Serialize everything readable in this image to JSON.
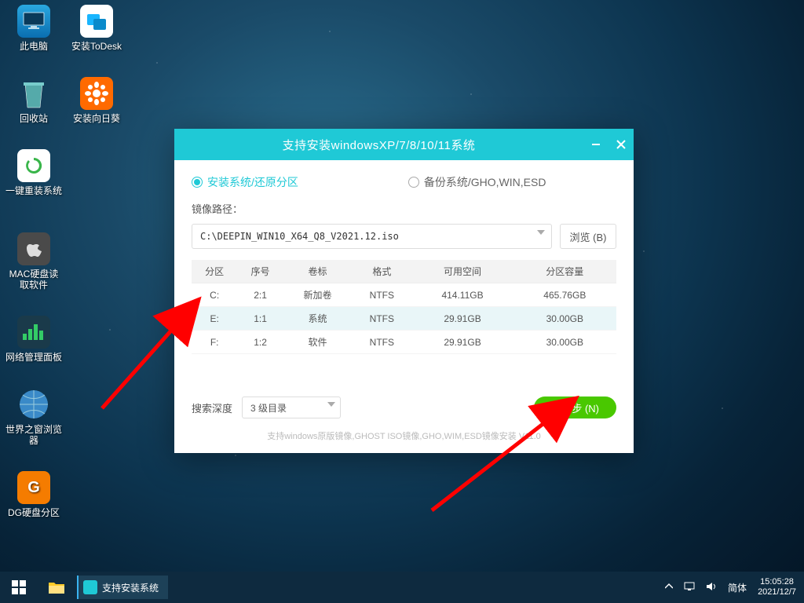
{
  "desktop": {
    "icons": [
      {
        "label": "此电脑"
      },
      {
        "label": "安装ToDesk"
      },
      {
        "label": "回收站"
      },
      {
        "label": "安装向日葵"
      },
      {
        "label": "一键重装系统"
      },
      {
        "label": "MAC硬盘读取软件"
      },
      {
        "label": "网络管理面板"
      },
      {
        "label": "世界之窗浏览器"
      },
      {
        "label": "DG硬盘分区"
      }
    ]
  },
  "installer": {
    "title": "支持安装windowsXP/7/8/10/11系统",
    "mode_install": "安装系统/还原分区",
    "mode_backup": "备份系统/GHO,WIN,ESD",
    "path_label": "镜像路径：",
    "path_value": "C:\\DEEPIN_WIN10_X64_Q8_V2021.12.iso",
    "browse": "浏览 (B)",
    "table": {
      "headers": [
        "分区",
        "序号",
        "卷标",
        "格式",
        "可用空间",
        "分区容量"
      ],
      "rows": [
        [
          "C:",
          "2:1",
          "新加卷",
          "NTFS",
          "414.11GB",
          "465.76GB"
        ],
        [
          "E:",
          "1:1",
          "系统",
          "NTFS",
          "29.91GB",
          "30.00GB"
        ],
        [
          "F:",
          "1:2",
          "软件",
          "NTFS",
          "29.91GB",
          "30.00GB"
        ]
      ],
      "selected": 1
    },
    "search_label": "搜索深度",
    "search_value": "3 级目录",
    "next": "下一步 (N)",
    "note": "支持windows原版镜像,GHOST ISO镜像,GHO,WIM,ESD镜像安装  V11.0"
  },
  "taskbar": {
    "app": "支持安装系统",
    "ime": "简体",
    "time": "15:05:28",
    "date": "2021/12/7"
  }
}
